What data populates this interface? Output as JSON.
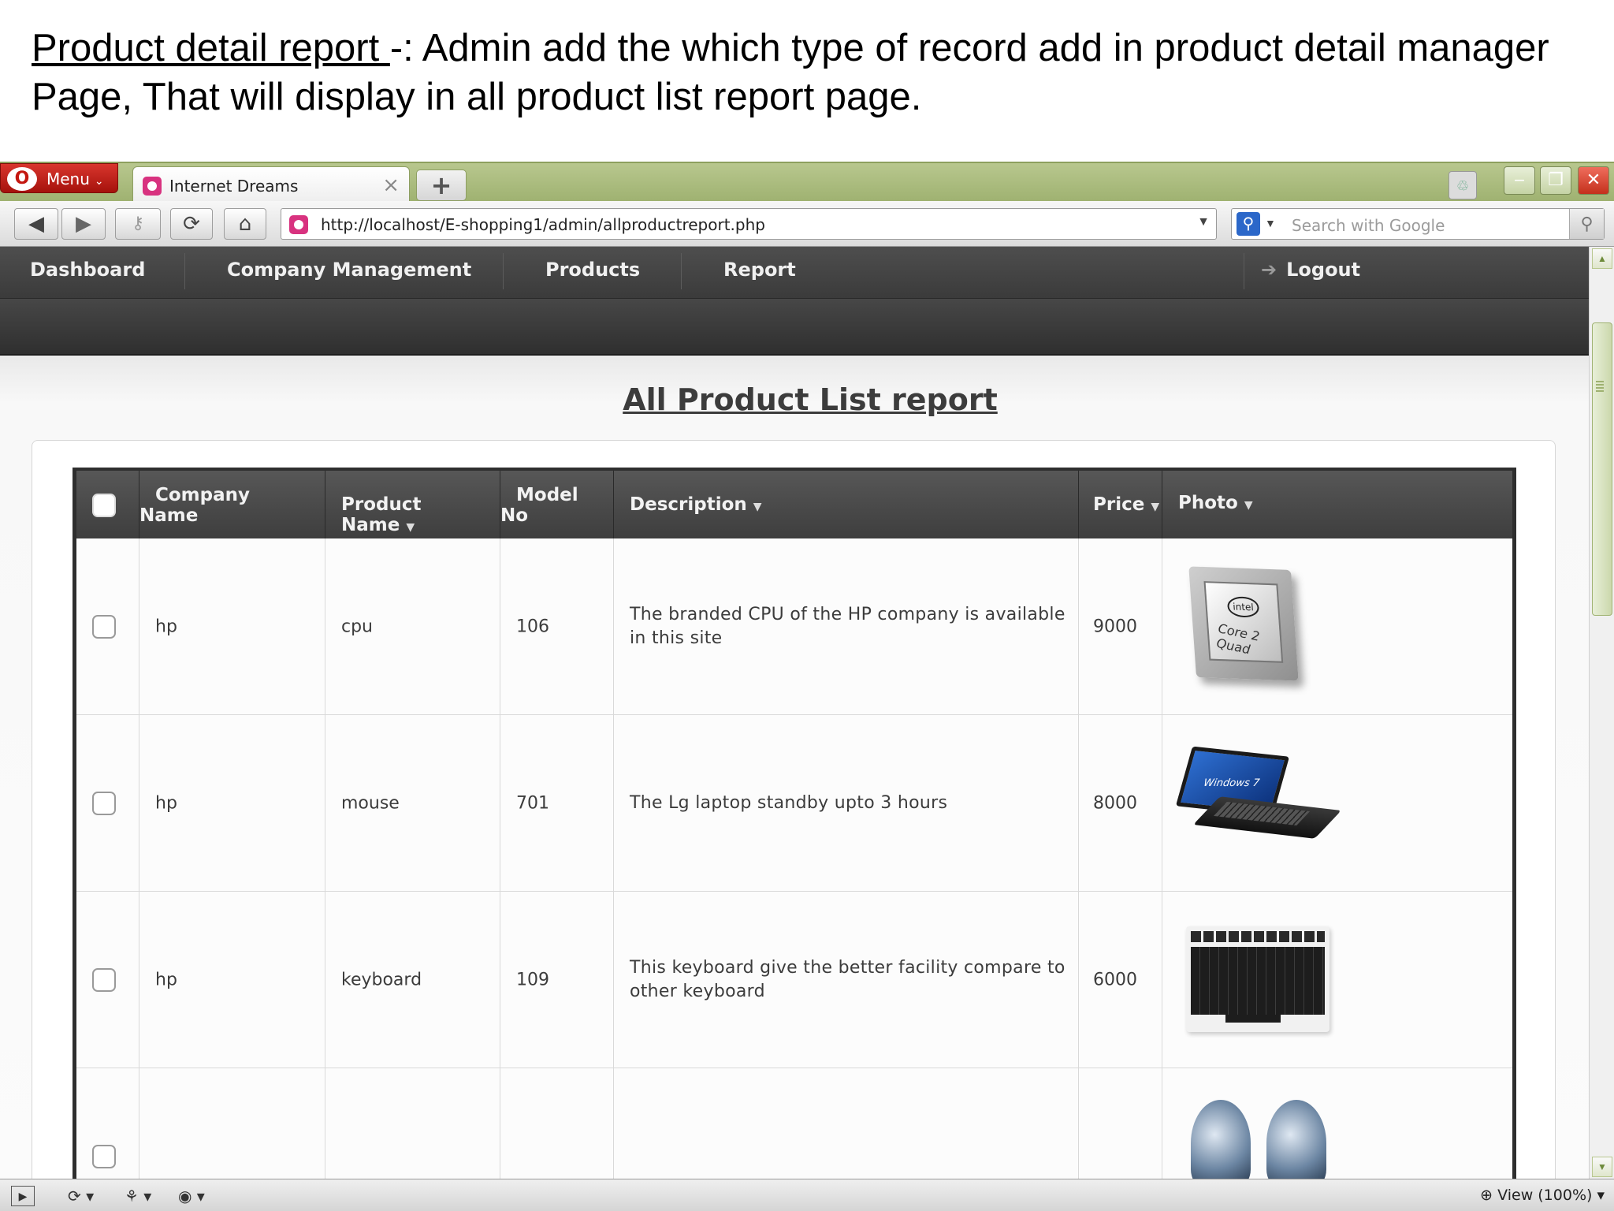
{
  "slide": {
    "caption_underlined": "Product detail report ",
    "caption_rest": "-: Admin add the which type of record add in product detail manager",
    "caption_line2": "Page, That will display in all product list report page."
  },
  "browser": {
    "menu_label": "Menu",
    "tab_title": "Internet Dreams",
    "url": "http://localhost/E-shopping1/admin/allproductreport.php",
    "search_placeholder": "Search with Google",
    "zoom_label": "View (100%)"
  },
  "nav": {
    "items": [
      "Dashboard",
      "Company Management",
      "Products",
      "Report"
    ],
    "logout": "Logout"
  },
  "page": {
    "title": "All Product List report"
  },
  "table": {
    "headers": {
      "company_line1": "Company",
      "company_line2": "Name",
      "product": "Product Name",
      "model_line1": "Model",
      "model_line2": "No",
      "description": "Description",
      "price": "Price",
      "photo": "Photo"
    },
    "rows": [
      {
        "company": "hp",
        "product": "cpu",
        "model": "106",
        "description": "The branded CPU of the HP company is available in this site",
        "price": "9000",
        "photo": "cpu-photo"
      },
      {
        "company": "hp",
        "product": "mouse",
        "model": "701",
        "description": "The Lg laptop standby upto 3 hours",
        "price": "8000",
        "photo": "laptop-photo"
      },
      {
        "company": "hp",
        "product": "keyboard",
        "model": "109",
        "description": "This keyboard give the better facility compare to other keyboard",
        "price": "6000",
        "photo": "keyboard-photo"
      }
    ],
    "photo_text": {
      "cpu_brand": "intel",
      "cpu_model": "Core 2 Quad",
      "laptop_logo": "Windows 7"
    }
  },
  "icons": {
    "back": "arrow-left-icon",
    "forward": "arrow-right-icon",
    "key": "key-icon",
    "reload": "reload-icon",
    "home": "home-icon",
    "search": "magnifier-icon",
    "logout": "arrow-right-icon"
  },
  "colors": {
    "nav_bg": "#444444",
    "tabbar_bg": "#a9b87d",
    "menu_red": "#c41710"
  }
}
